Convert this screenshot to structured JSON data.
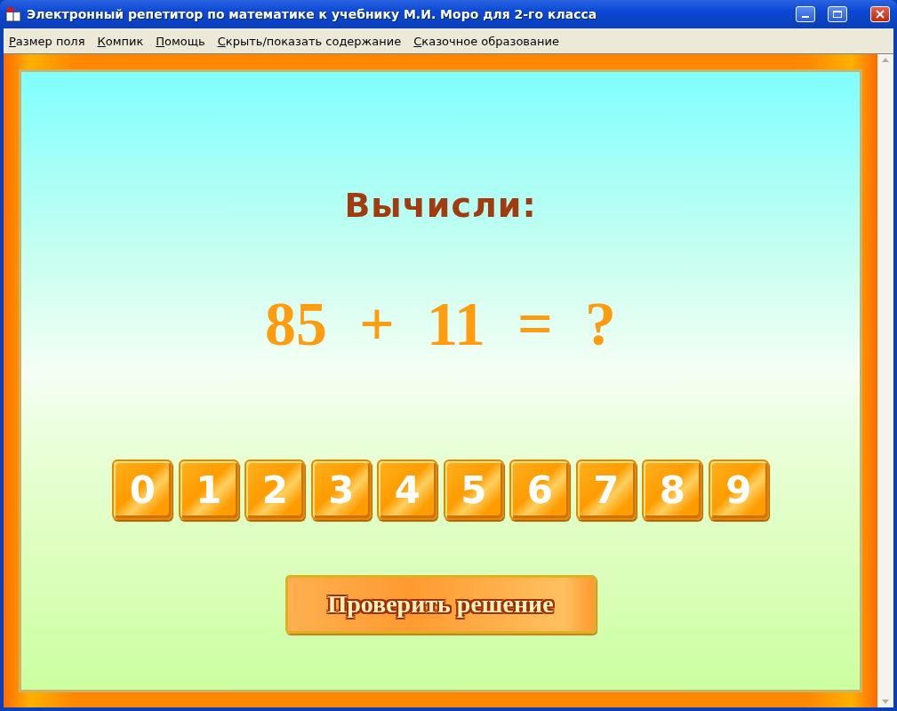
{
  "window": {
    "title": "Электронный репетитор по математике к учебнику М.И. Моро для 2-го класса"
  },
  "menu": [
    {
      "label": "Размер поля"
    },
    {
      "label": "Компик"
    },
    {
      "label": "Помощь"
    },
    {
      "label": "Скрыть/показать содержание"
    },
    {
      "label": "Сказочное образование"
    }
  ],
  "task": {
    "heading": "Вычисли:",
    "equation": [
      "85",
      "+",
      "11",
      "=",
      "?"
    ]
  },
  "digit_keys": [
    "0",
    "1",
    "2",
    "3",
    "4",
    "5",
    "6",
    "7",
    "8",
    "9"
  ],
  "check_button": {
    "label": "Проверить решение"
  }
}
